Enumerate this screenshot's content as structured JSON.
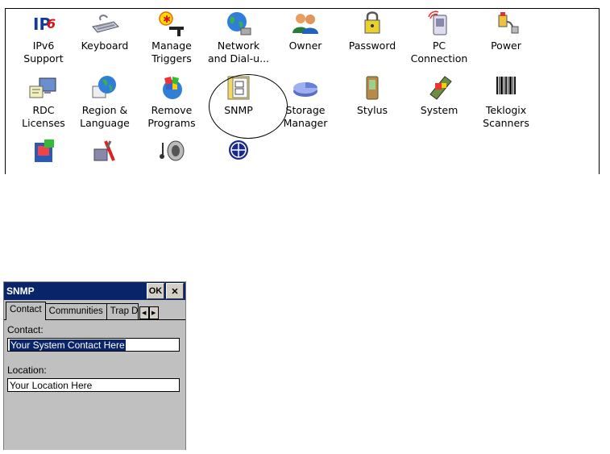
{
  "control_panel": {
    "items": [
      {
        "label": "IPv6\nSupport",
        "icon": "ipv6-icon"
      },
      {
        "label": "Keyboard",
        "icon": "keyboard-icon"
      },
      {
        "label": "Manage\nTriggers",
        "icon": "trigger-icon"
      },
      {
        "label": "Network\nand Dial-u...",
        "icon": "network-globe-icon"
      },
      {
        "label": "Owner",
        "icon": "owner-people-icon"
      },
      {
        "label": "Password",
        "icon": "password-keys-icon"
      },
      {
        "label": "PC\nConnection",
        "icon": "pc-connection-icon"
      },
      {
        "label": "Power",
        "icon": "power-plug-icon"
      },
      {
        "label": "RDC\nLicenses",
        "icon": "rdc-licenses-icon"
      },
      {
        "label": "Region &\nLanguage",
        "icon": "region-globe-icon"
      },
      {
        "label": "Remove\nPrograms",
        "icon": "remove-programs-icon"
      },
      {
        "label": "SNMP",
        "icon": "snmp-folder-icon"
      },
      {
        "label": "Storage\nManager",
        "icon": "storage-pie-icon"
      },
      {
        "label": "Stylus",
        "icon": "stylus-device-icon"
      },
      {
        "label": "System",
        "icon": "system-device-icon"
      },
      {
        "label": "Teklogix\nScanners",
        "icon": "barcode-icon"
      }
    ]
  },
  "dialog": {
    "title": "SNMP",
    "ok_label": "OK",
    "close_label": "✕",
    "tabs": [
      "Contact",
      "Communities",
      "Trap Desti"
    ],
    "contact_label": "Contact:",
    "contact_value": "Your System Contact Here",
    "location_label": "Location:",
    "location_value": "Your Location Here"
  }
}
